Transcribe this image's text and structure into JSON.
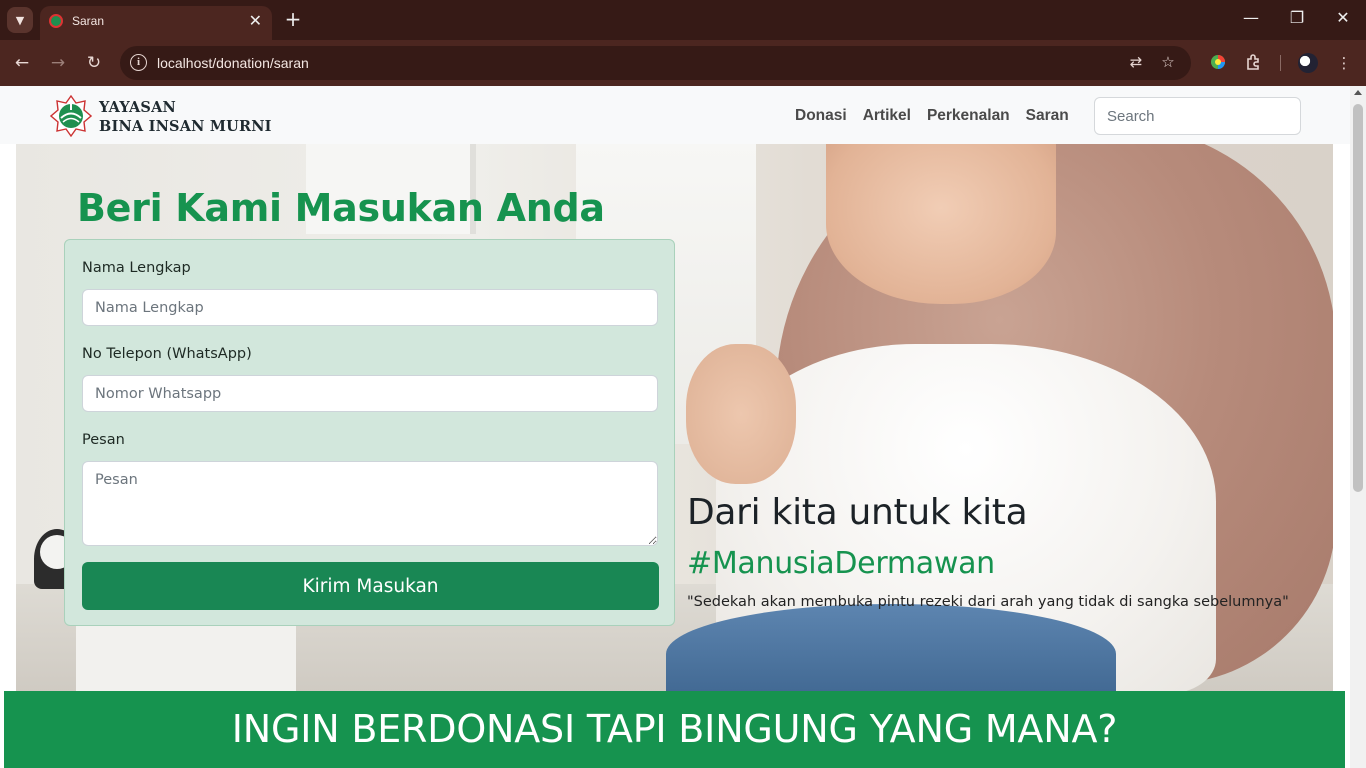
{
  "browser": {
    "tab_title": "Saran",
    "url": "localhost/donation/saran",
    "new_tab_symbol": "+",
    "close_tab_symbol": "✕",
    "window_controls": {
      "minimize": "—",
      "restore": "❐",
      "close": "✕"
    }
  },
  "site": {
    "brand_line1": "YAYASAN",
    "brand_line2": "BINA INSAN MURNI",
    "nav": [
      "Donasi",
      "Artikel",
      "Perkenalan",
      "Saran"
    ],
    "search_placeholder": "Search"
  },
  "hero": {
    "title": "Beri Kami Masukan Anda",
    "form": {
      "name_label": "Nama Lengkap",
      "name_placeholder": "Nama Lengkap",
      "phone_label": "No Telepon (WhatsApp)",
      "phone_placeholder": "Nomor Whatsapp",
      "message_label": "Pesan",
      "message_placeholder": "Pesan",
      "submit_label": "Kirim Masukan"
    },
    "tagline": "Dari kita untuk kita",
    "hashtag": "#ManusiaDermawan",
    "quote": "\"Sedekah akan membuka pintu rezeki dari arah yang tidak di sangka sebelumnya\""
  },
  "banner": {
    "text": "INGIN BERDONASI TAPI BINGUNG YANG MANA?"
  },
  "colors": {
    "brand_green": "#16934f",
    "button_green": "#198754",
    "form_bg": "#d2e7dc",
    "chrome_dark": "#361a16",
    "chrome_toolbar": "#4c2620"
  },
  "icons": {
    "tab_menu": "chevron-down-icon",
    "back": "arrow-left-icon",
    "forward": "arrow-right-icon",
    "reload": "reload-icon",
    "site_info": "info-icon",
    "translate": "translate-icon",
    "bookmark": "star-icon",
    "extension_color": "extension-color-icon",
    "extensions": "puzzle-icon",
    "profile": "profile-avatar-icon",
    "menu": "kebab-menu-icon"
  }
}
